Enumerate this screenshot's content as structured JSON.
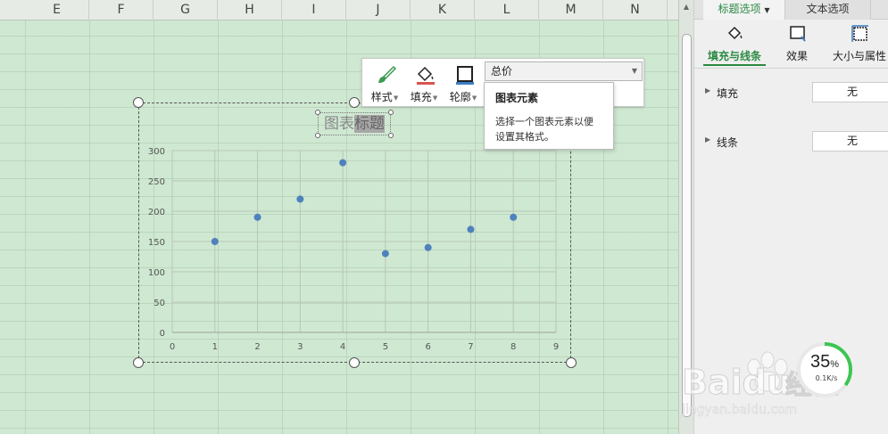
{
  "sheet": {
    "columns": [
      "E",
      "F",
      "G",
      "H",
      "I",
      "J",
      "K",
      "L",
      "M",
      "N"
    ]
  },
  "chart": {
    "title_part1": "图表",
    "title_part2": "标题"
  },
  "chart_data": {
    "type": "scatter",
    "title": "图表标题",
    "xlabel": "",
    "ylabel": "",
    "x_ticks": [
      0,
      1,
      2,
      3,
      4,
      5,
      6,
      7,
      8,
      9
    ],
    "y_ticks": [
      0,
      50,
      100,
      150,
      200,
      250,
      300
    ],
    "xlim": [
      0,
      9
    ],
    "ylim": [
      0,
      300
    ],
    "grid": true,
    "marker_color": "#4f81bd",
    "series": [
      {
        "x": [
          1,
          2,
          3,
          4,
          5,
          6,
          7,
          8
        ],
        "y": [
          150,
          190,
          220,
          280,
          130,
          140,
          170,
          190
        ]
      }
    ]
  },
  "toolbar": {
    "style_label": "样式",
    "fill_label": "填充",
    "outline_label": "轮廓",
    "series_select": "总价"
  },
  "tooltip": {
    "title": "图表元素",
    "body": "选择一个图表元素以便设置其格式。"
  },
  "pane": {
    "tab_title_options": "标题选项",
    "tab_text_options": "文本选项",
    "subtab_fill_line": "填充与线条",
    "subtab_effects": "效果",
    "subtab_size_props": "大小与属性",
    "fill_label": "填充",
    "fill_value": "无",
    "line_label": "线条",
    "line_value": "无"
  },
  "progress": {
    "percent": 35,
    "value_text": "35",
    "unit": "%",
    "speed": "0.1K/s"
  },
  "watermark": {
    "brand": "Baidu",
    "brand_cn": "经验",
    "url": "jingyan.baidu.com"
  },
  "colors": {
    "accent": "#2a8a42",
    "marker": "#4f81bd",
    "sheet_bg": "#cfe8d2"
  }
}
